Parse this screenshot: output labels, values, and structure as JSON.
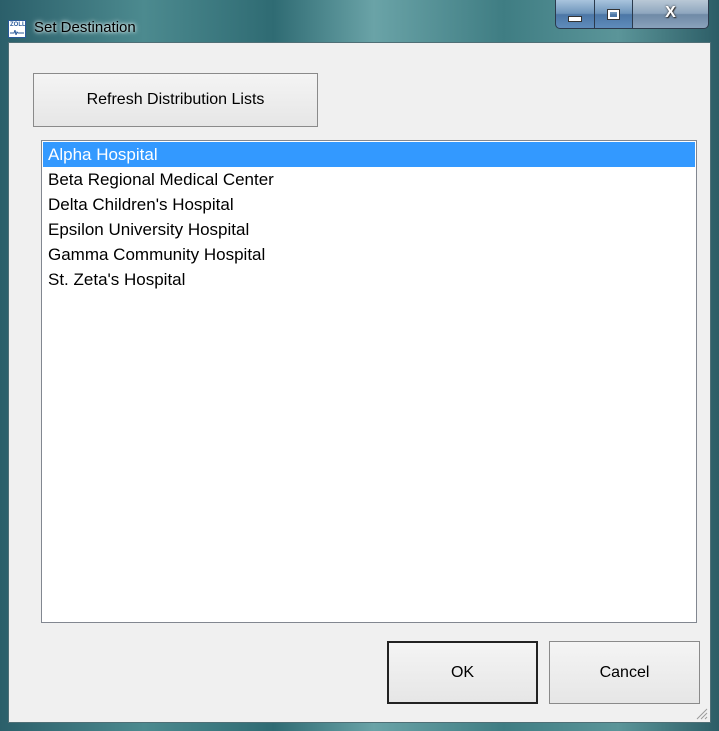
{
  "window": {
    "title": "Set Destination",
    "app_icon": "zoll-app-icon",
    "app_icon_text": "ZOLL",
    "caption_buttons": [
      "minimize-icon",
      "maximize-icon",
      "close-icon"
    ],
    "close_glyph": "X"
  },
  "toolbar": {
    "refresh_label": "Refresh Distribution Lists"
  },
  "destination_list": {
    "selected_index": 0,
    "selection_color": "#3399ff",
    "items": [
      "Alpha Hospital",
      "Beta Regional Medical Center",
      "Delta Children's Hospital",
      "Epsilon University Hospital",
      "Gamma Community Hospital",
      "St. Zeta's Hospital"
    ]
  },
  "footer": {
    "ok_label": "OK",
    "cancel_label": "Cancel"
  }
}
